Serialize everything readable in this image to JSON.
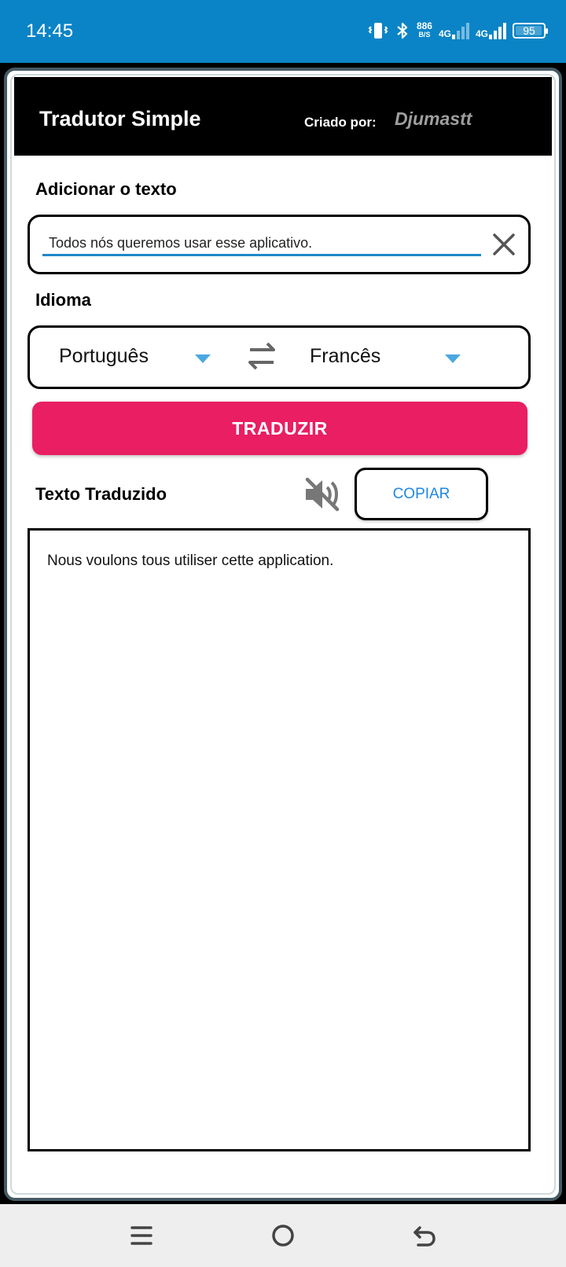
{
  "status_bar": {
    "time": "14:45",
    "speed_value": "886",
    "speed_unit": "B/S",
    "network_1": "4G",
    "network_2": "4G",
    "battery": "95"
  },
  "header": {
    "title": "Tradutor Simple",
    "created_by_label": "Criado por:",
    "author": "Djumastt"
  },
  "input_section": {
    "label": "Adicionar o texto",
    "value": "Todos nós queremos usar esse aplicativo."
  },
  "language_section": {
    "label": "Idioma",
    "source_language": "Português",
    "target_language": "Francês"
  },
  "translate_button": "TRADUZIR",
  "output_section": {
    "label": "Texto Traduzido",
    "copy_button": "COPIAR",
    "text": "Nous voulons tous utiliser cette application."
  },
  "icons": {
    "clear": "close-icon",
    "swap": "swap-icon",
    "mute": "volume-off-icon",
    "dropdown": "caret-down-icon",
    "nav_menu": "menu-icon",
    "nav_home": "home-circle-icon",
    "nav_back": "back-icon"
  },
  "colors": {
    "status_bar": "#0a84c6",
    "header_bg": "#000000",
    "accent_underline": "#1e88c8",
    "translate_button": "#e91e63",
    "copy_text": "#1e88e5",
    "caret": "#4aa8e0",
    "author": "#9e9e9e"
  }
}
